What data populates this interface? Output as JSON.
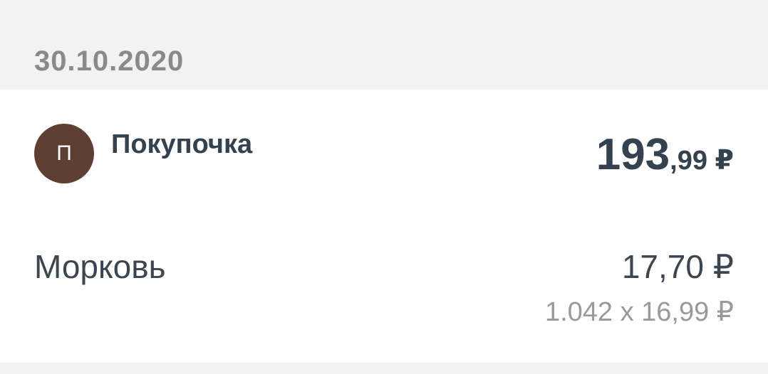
{
  "date": "30.10.2020",
  "receipt": {
    "avatar_letter": "П",
    "store_name": "Покупочка",
    "total_integer": "193",
    "total_fraction": ",99",
    "total_currency": " ₽"
  },
  "items": [
    {
      "name": "Морковь",
      "price": "17,70 ₽",
      "quantity_line": "1.042 x 16,99 ₽"
    }
  ],
  "colors": {
    "background": "#f2f2f2",
    "card": "#ffffff",
    "avatar": "#5e3f34",
    "primary_text": "#34414f",
    "secondary_text": "#9a9a9a"
  }
}
